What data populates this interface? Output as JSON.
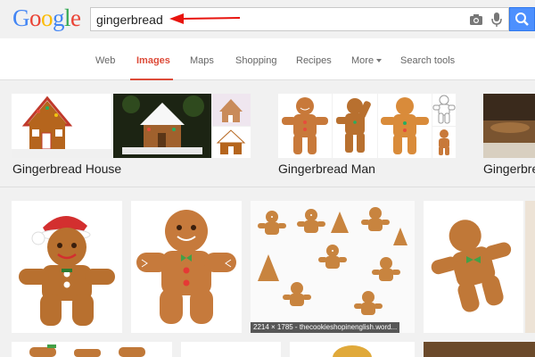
{
  "header": {
    "logo_letters": [
      {
        "ch": "G",
        "color": "#4285f4"
      },
      {
        "ch": "o",
        "color": "#ea4335"
      },
      {
        "ch": "o",
        "color": "#fbbc05"
      },
      {
        "ch": "g",
        "color": "#4285f4"
      },
      {
        "ch": "l",
        "color": "#34a853"
      },
      {
        "ch": "e",
        "color": "#ea4335"
      }
    ],
    "search_value": "gingerbread"
  },
  "tabs": [
    {
      "label": "Web",
      "active": false
    },
    {
      "label": "Images",
      "active": true
    },
    {
      "label": "Maps",
      "active": false
    },
    {
      "label": "Shopping",
      "active": false
    },
    {
      "label": "Recipes",
      "active": false
    },
    {
      "label": "More",
      "active": false
    },
    {
      "label": "Search tools",
      "active": false
    }
  ],
  "related": [
    {
      "label": "Gingerbread House"
    },
    {
      "label": "Gingerbread Man"
    },
    {
      "label": "Gingerbre"
    }
  ],
  "results": [
    {
      "caption": ""
    },
    {
      "caption": ""
    },
    {
      "caption": "2214 × 1785 - thecookieshopinenglish.word..."
    },
    {
      "caption": ""
    }
  ],
  "colors": {
    "accent": "#dd4b39",
    "search_blue": "#4d90fe",
    "arrow_red": "#e8140e"
  }
}
